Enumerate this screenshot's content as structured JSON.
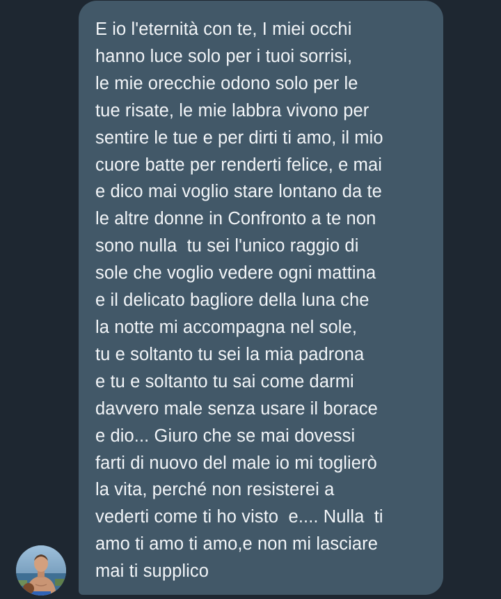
{
  "colors": {
    "background": "#1e2731",
    "bubble": "#425868",
    "text": "#f2f5f8"
  },
  "message": {
    "lines": [
      "E io l'eternità con te, I miei occhi",
      "hanno luce solo per i tuoi sorrisi,",
      "le mie orecchie odono solo per le",
      "tue risate, le mie labbra vivono per",
      "sentire le tue e per dirti ti amo, il mio",
      "cuore batte per renderti felice, e mai",
      "e dico mai voglio stare lontano da te",
      "le altre donne in Confronto a te non",
      "sono nulla  tu sei l'unico raggio di",
      "sole che voglio vedere ogni mattina",
      "e il delicato bagliore della luna che",
      "la notte mi accompagna nel sole,",
      "tu e soltanto tu sei la mia padrona",
      "e tu e soltanto tu sai come darmi",
      "davvero male senza usare il borace",
      "e dio... Giuro che se mai dovessi",
      "farti di nuovo del male io mi toglierò",
      "la vita, perché non resisterei a",
      "vederti come ti ho visto  e.... Nulla  ti",
      "amo ti amo ti amo,e non mi lasciare",
      "mai ti supplico"
    ]
  },
  "avatar": {
    "icon": "user-photo-avatar"
  }
}
